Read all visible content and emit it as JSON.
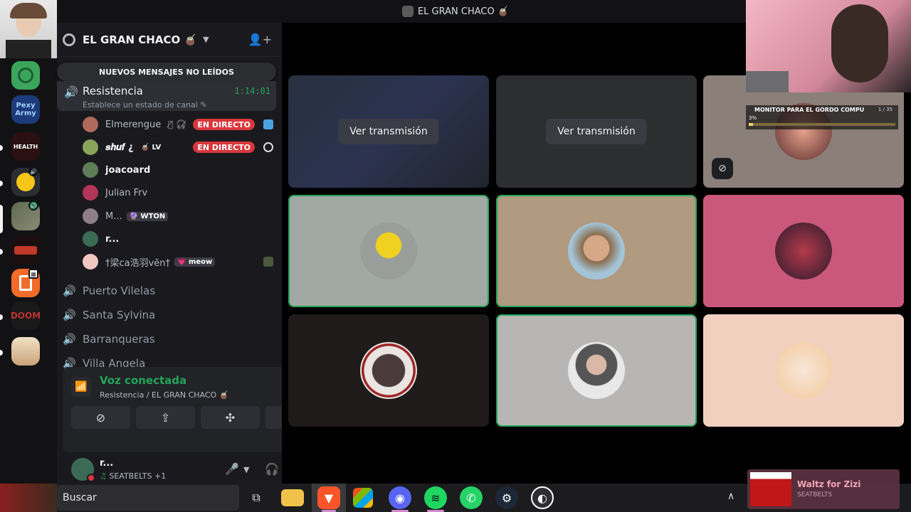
{
  "window": {
    "title": "EL GRAN CHACO 🧉"
  },
  "rail": {
    "servers": [
      {
        "name": "green-server-icon",
        "label": ""
      },
      {
        "name": "pexy-army-server-icon",
        "label": "Pexy Army"
      },
      {
        "name": "health-server-icon",
        "label": "HEALTH"
      },
      {
        "name": "duck-server-icon",
        "label": ""
      },
      {
        "name": "war-server-icon",
        "label": ""
      },
      {
        "name": "red-logo-server-icon",
        "label": ""
      },
      {
        "name": "orange-server-icon",
        "label": ""
      },
      {
        "name": "doom-server-icon",
        "label": "DOOM"
      },
      {
        "name": "anime-server-icon",
        "label": ""
      }
    ]
  },
  "guild": {
    "name": "EL GRAN CHACO 🧉"
  },
  "banner": {
    "text": "NUEVOS MENSAJES NO LEÍDOS"
  },
  "voice_channel": {
    "name": "Resistencia",
    "timer": "1:14:01",
    "status": "Establece un estado de canal ✎"
  },
  "members": [
    {
      "name": "Elmerengue",
      "tag": "",
      "live": "EN DIRECTO",
      "color": "#b06a5c"
    },
    {
      "name": "𝒔𝒉𝒖𝒇 ¿",
      "tag": "🧉 LV",
      "live": "EN DIRECTO",
      "color": "#8aa35a"
    },
    {
      "name": "joacoard",
      "tag": "",
      "live": "",
      "color": "#5e7e58"
    },
    {
      "name": "Julian Frv",
      "tag": "",
      "live": "",
      "color": "#b4355a"
    },
    {
      "name": "M...",
      "tag": "🔮 WTON",
      "live": "",
      "color": "#8f7e86"
    },
    {
      "name": "r...",
      "tag": "",
      "live": "",
      "color": "#3c6b55"
    },
    {
      "name": "†梁ca浩羽vēn†",
      "tag": "💗 meow",
      "live": "",
      "color": "#f1c7c2"
    }
  ],
  "channels": [
    "Puerto Vilelas",
    "Santa Sylvina",
    "Barranqueras",
    "Villa Angela"
  ],
  "voice_panel": {
    "status": "Voz conectada",
    "location": "Resistencia / EL GRAN CHACO 🧉"
  },
  "user": {
    "name": "r...",
    "activity": "SEATBELTS +1"
  },
  "stage": {
    "watch_label": "Ver transmisión",
    "cam_overlay_title": "MONITOR PARA EL GORDO COMPU",
    "cam_overlay_count": "1 / 35",
    "cam_overlay_progress": "3%",
    "cam_overlay_progress_value": 0.03
  },
  "taskbar": {
    "search": "Buscar"
  },
  "music": {
    "title": "Waltz for Zizi",
    "artist": "SEATBELTS"
  },
  "colors": {
    "accent_green": "#23a55a",
    "live_red": "#da373c",
    "background": "#121214"
  }
}
